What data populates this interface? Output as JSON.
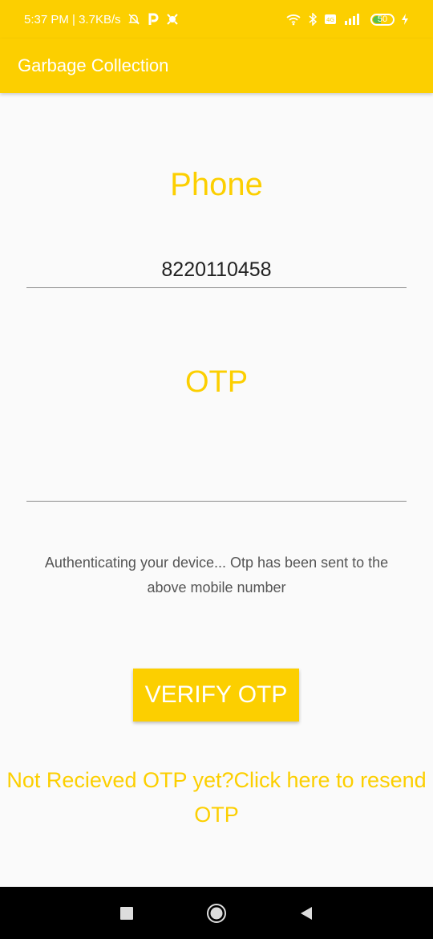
{
  "status_bar": {
    "time_speed": "5:37 PM | 3.7KB/s",
    "icons": [
      "mute-bell-icon",
      "parking-icon",
      "app-icon"
    ],
    "right_icons": [
      "wifi-icon",
      "bluetooth-icon",
      "volte-icon",
      "signal-icon"
    ],
    "battery": "50"
  },
  "app_bar": {
    "title": "Garbage Collection"
  },
  "phone": {
    "label": "Phone",
    "value": "8220110458"
  },
  "otp": {
    "label": "OTP",
    "value": ""
  },
  "info_text": "Authenticating your device... Otp has been sent to the above mobile number",
  "verify_button": "VERIFY OTP",
  "resend_text": "Not Recieved OTP yet?Click here to resend OTP",
  "colors": {
    "accent": "#fccf00",
    "background": "#fafafa"
  },
  "nav_bar": {
    "icons": [
      "square-icon",
      "home-circle-icon",
      "back-triangle-icon"
    ]
  }
}
